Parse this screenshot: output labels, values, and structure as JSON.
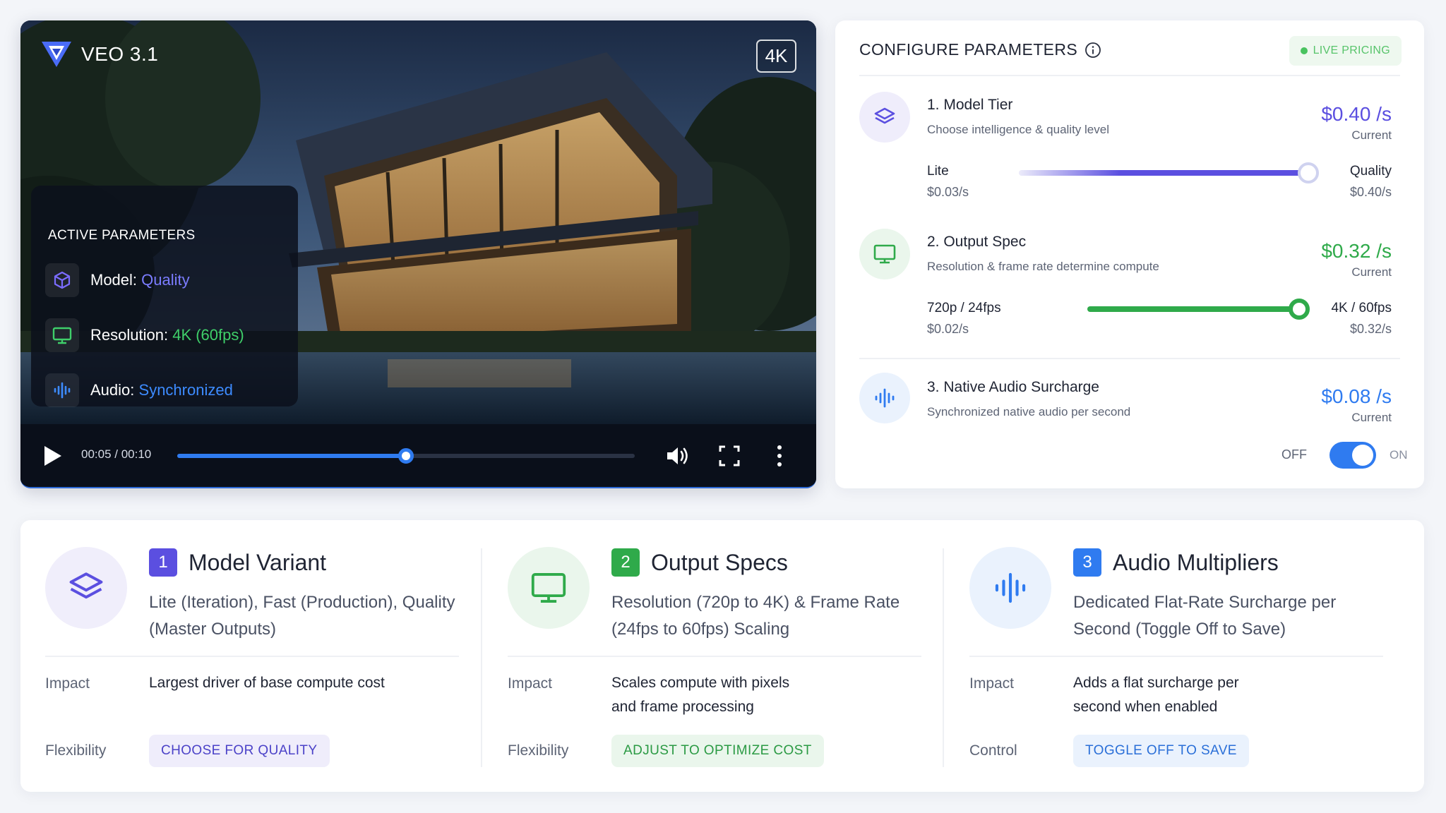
{
  "player": {
    "brand": "VEO 3.1",
    "quality_badge": "4K",
    "active_panel": {
      "title": "ACTIVE PARAMETERS",
      "model_label": "Model:",
      "model_value": "Quality",
      "resolution_label": "Resolution:",
      "resolution_value": "4K (60fps)",
      "audio_label": "Audio:",
      "audio_value": "Synchronized"
    },
    "time": "00:05 / 00:10",
    "progress": 0.5
  },
  "config": {
    "title": "CONFIGURE PARAMETERS",
    "live_badge": "LIVE PRICING",
    "sections": [
      {
        "title": "1. Model Tier",
        "subtitle": "Choose intelligence & quality level",
        "price": "$0.40",
        "unit": "/s",
        "current": "Current",
        "min_label": "Lite",
        "min_value": "$0.03/s",
        "max_label": "Quality",
        "max_value": "$0.40/s",
        "level": 1.0
      },
      {
        "title": "2. Output Spec",
        "subtitle": "Resolution & frame rate determine compute",
        "price": "$0.32",
        "unit": "/s",
        "current": "Current",
        "min_label": "720p / 24fps",
        "min_value": "$0.02/s",
        "max_label": "4K / 60fps",
        "max_value": "$0.32/s",
        "level": 1.0
      },
      {
        "title": "3. Native Audio Surcharge",
        "subtitle": "Synchronized native audio per second",
        "price": "$0.08",
        "unit": "/s",
        "current": "Current",
        "off_label": "OFF",
        "on_label": "ON",
        "enabled": true
      }
    ]
  },
  "cards": [
    {
      "number": "1",
      "heading": "Model Variant",
      "description": "Lite (Iteration), Fast (Production), Quality (Master Outputs)",
      "impact_label": "Impact",
      "impact_text": "Largest driver of base compute cost",
      "second_label": "Flexibility",
      "pill": "CHOOSE FOR QUALITY"
    },
    {
      "number": "2",
      "heading": "Output Specs",
      "description": "Resolution (720p to 4K) & Frame Rate (24fps to 60fps) Scaling",
      "impact_label": "Impact",
      "impact_text": "Scales compute with pixels and frame processing",
      "second_label": "Flexibility",
      "pill": "ADJUST TO OPTIMIZE COST"
    },
    {
      "number": "3",
      "heading": "Audio Multipliers",
      "description": "Dedicated Flat-Rate Surcharge per Second (Toggle Off to Save)",
      "impact_label": "Impact",
      "impact_text": "Adds a flat surcharge per second when enabled",
      "second_label": "Control",
      "pill": "TOGGLE OFF TO SAVE"
    }
  ],
  "colors": {
    "purple": "#5b4fe0",
    "green": "#2faa4a",
    "blue": "#2f7bf0"
  },
  "icons": {
    "model": "layers-icon",
    "output": "monitor-icon",
    "audio": "audio-wave-icon"
  }
}
